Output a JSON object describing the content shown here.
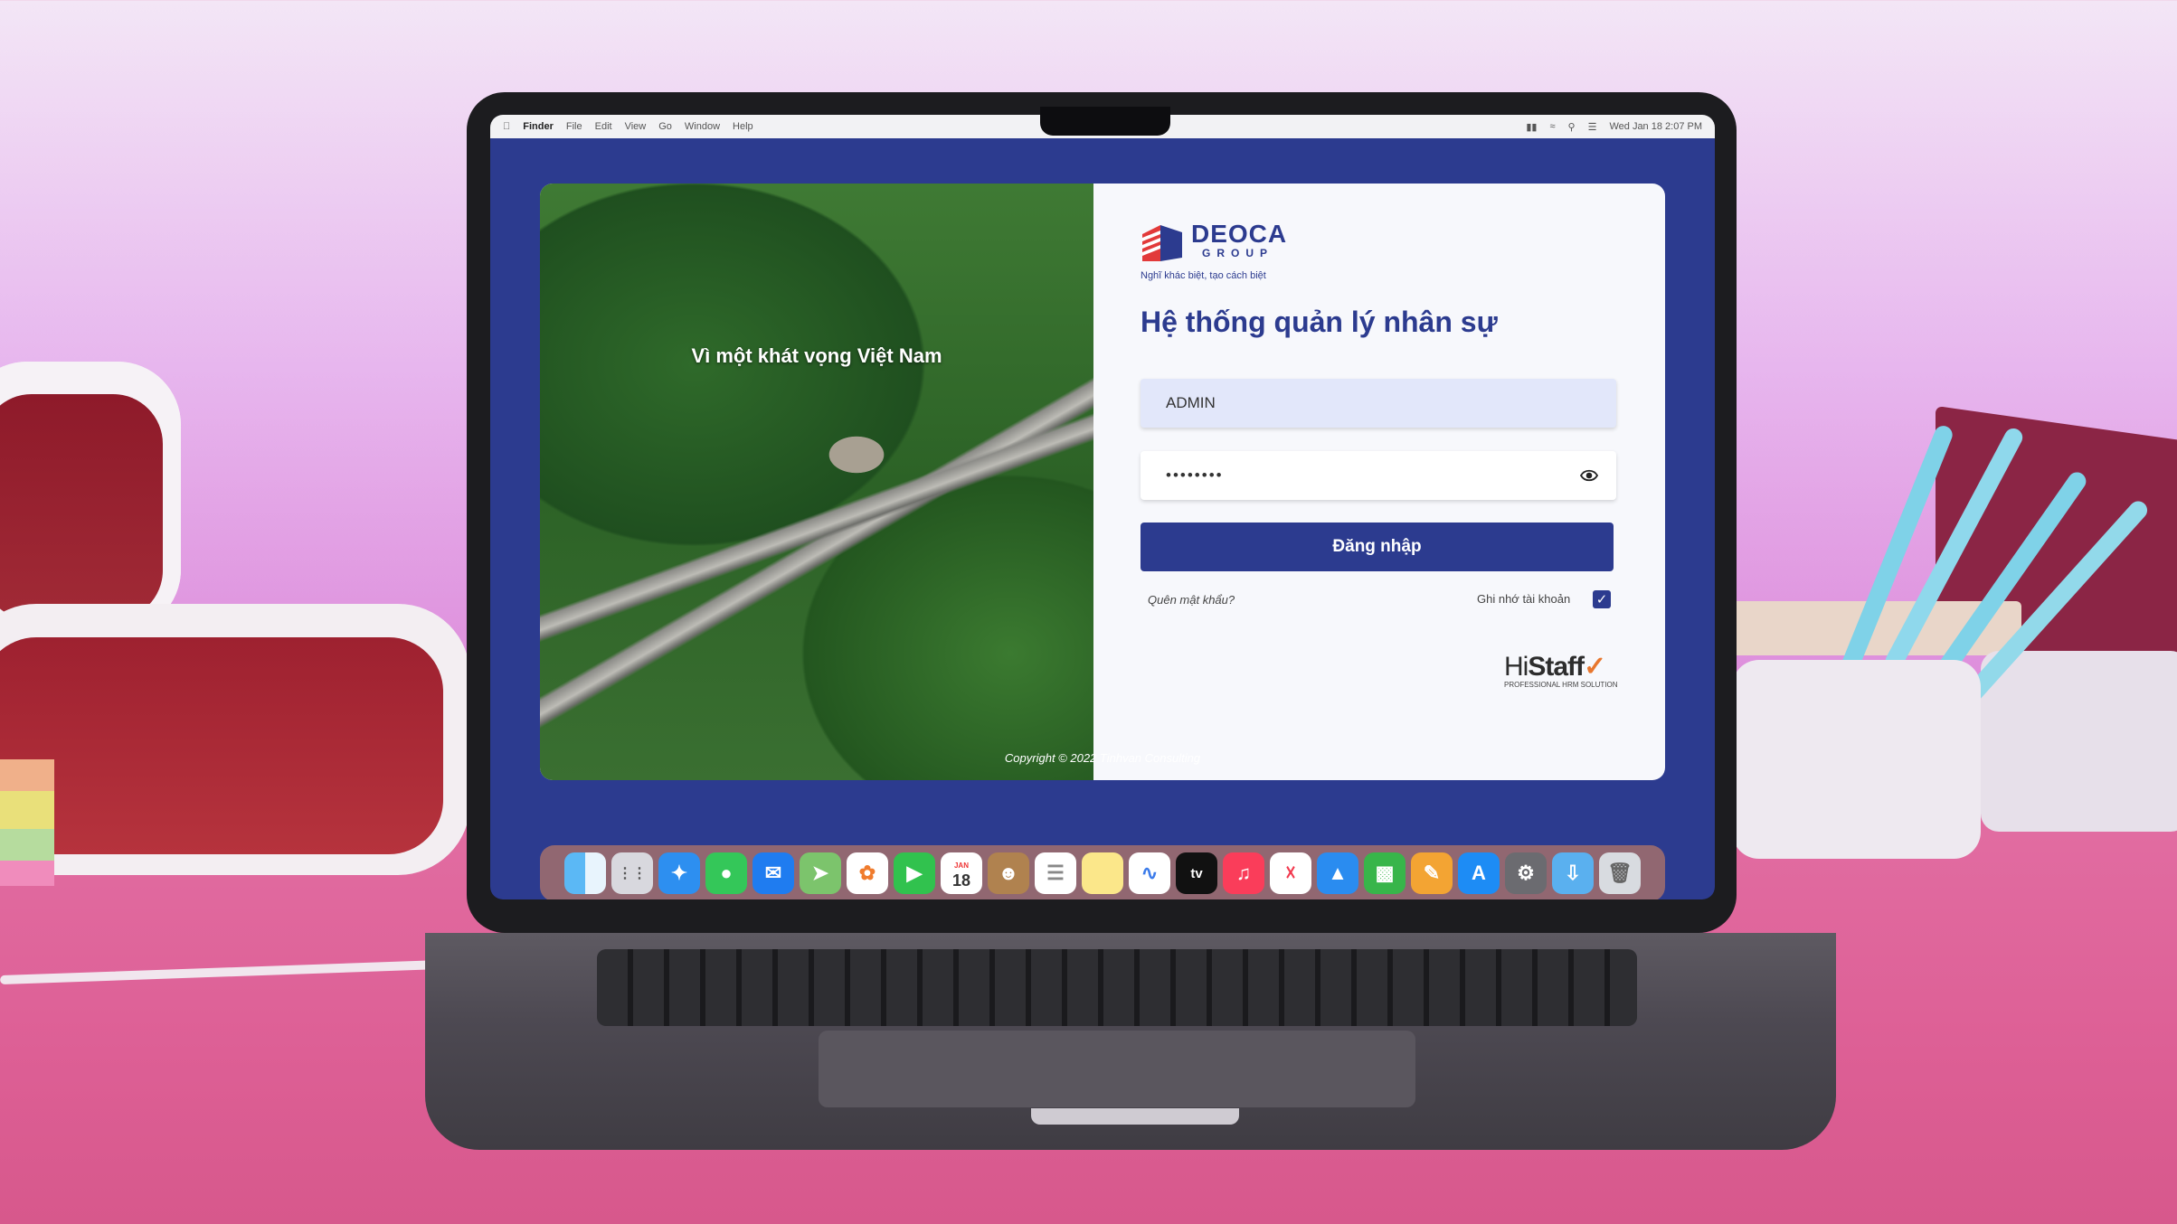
{
  "menubar": {
    "app": "Finder",
    "items": [
      "File",
      "Edit",
      "View",
      "Go",
      "Window",
      "Help"
    ],
    "clock": "Wed Jan 18  2:07 PM"
  },
  "photo": {
    "caption": "Vì một khát vọng Việt Nam"
  },
  "logo": {
    "name": "DEOCA",
    "group": "GROUP",
    "slogan": "Nghĩ khác biệt, tạo cách biệt"
  },
  "login": {
    "title": "Hệ thống quản lý nhân sự",
    "username_value": "ADMIN",
    "password_value": "••••••••",
    "submit_label": "Đăng nhập",
    "forgot_label": "Quên mật khẩu?",
    "remember_label": "Ghi nhớ tài khoản",
    "remember_checked": true
  },
  "vendor": {
    "name_prefix": "Hi",
    "name_main": "Staff",
    "tagline": "PROFESSIONAL HRM SOLUTION"
  },
  "footer": {
    "copyright": "Copyright © 2022 Tinhvan Consulting"
  },
  "dock": {
    "calendar_day": "18",
    "calendar_month": "JAN",
    "tv_label": "tv",
    "icons": [
      "finder-icon",
      "launchpad-icon",
      "safari-icon",
      "messages-icon",
      "mail-icon",
      "maps-icon",
      "photos-icon",
      "facetime-icon",
      "calendar-icon",
      "contacts-icon",
      "reminders-icon",
      "notes-icon",
      "freeform-icon",
      "appletv-icon",
      "music-icon",
      "news-icon",
      "keynote-icon",
      "numbers-icon",
      "pages-icon",
      "appstore-icon",
      "settings-icon",
      "downloads-icon",
      "trash-icon"
    ]
  },
  "colors": {
    "brand": "#2c3b8f",
    "accent_orange": "#e8772e"
  }
}
